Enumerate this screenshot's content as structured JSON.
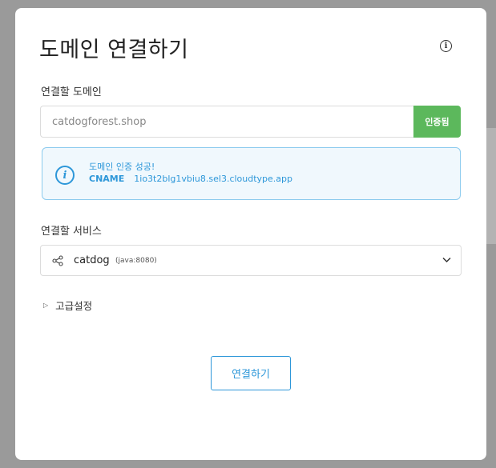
{
  "dialog": {
    "title": "도메인 연결하기",
    "info_icon": "info-circle-icon"
  },
  "domain_section": {
    "label": "연결할 도메인",
    "input_value": "catdogforest.shop",
    "verify_button": "인증됨",
    "verify_button_color": "#5cb85c"
  },
  "alert": {
    "icon": "info-circle-icon",
    "message": "도메인 인증 성공!",
    "cname_key": "CNAME",
    "cname_value": "1io3t2blg1vbiu8.sel3.cloudtype.app",
    "color": "#2d97d9"
  },
  "service_section": {
    "label": "연결할 서비스",
    "icon": "share-icon",
    "selected_name": "catdog",
    "selected_runtime": "(java:8080)",
    "dropdown_icon": "chevron-down-icon"
  },
  "advanced": {
    "caret_icon": "caret-right-icon",
    "label": "고급설정"
  },
  "connect_button": {
    "label": "연결하기",
    "color": "#2d97d9"
  }
}
